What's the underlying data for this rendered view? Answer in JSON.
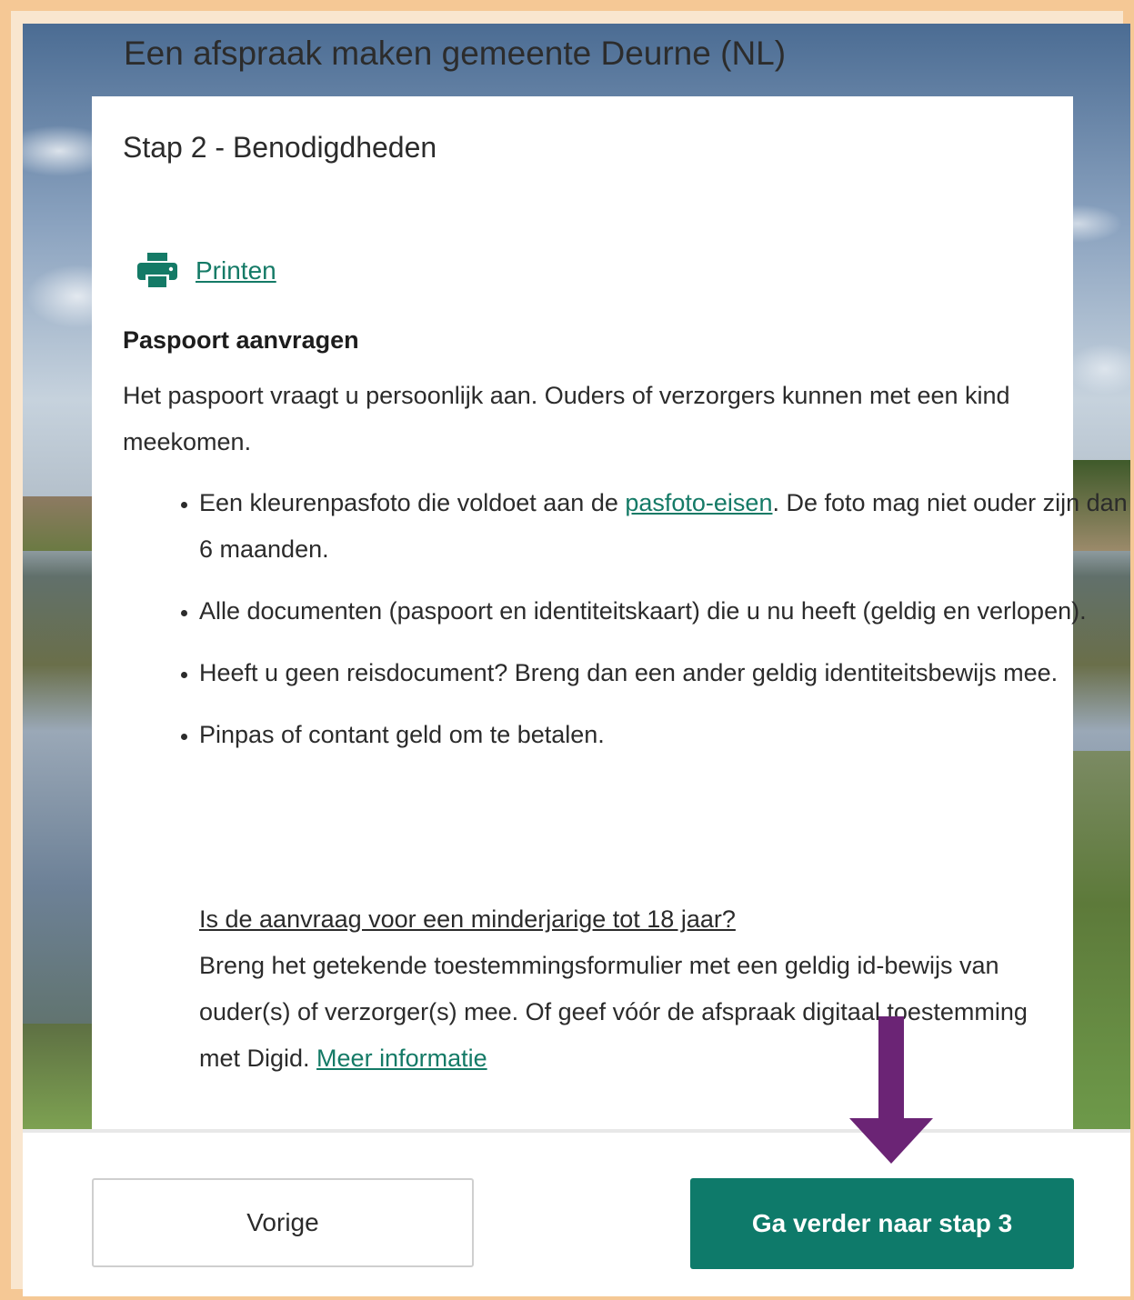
{
  "header": {
    "title": "Een afspraak maken gemeente Deurne (NL)"
  },
  "card": {
    "step_title": "Stap 2 - Benodigdheden",
    "print_label": "Printen",
    "section_heading": "Paspoort aanvragen",
    "intro": "Het paspoort vraagt u persoonlijk aan. Ouders of verzorgers kunnen met een kind meekomen.",
    "bullets": [
      {
        "before": "Een kleurenpasfoto die voldoet aan de ",
        "link": "pasfoto-eisen",
        "after": ". De foto mag niet ouder zijn dan 6 maanden."
      },
      {
        "text": "Alle documenten (paspoort en identiteitskaart) die u nu heeft (geldig en verlopen)."
      },
      {
        "text": "Heeft u geen reisdocument? Breng dan een ander geldig identiteitsbewijs mee."
      },
      {
        "text": "Pinpas of contant geld om te betalen."
      }
    ],
    "minor": {
      "question": "Is de aanvraag voor een minderjarige tot 18 jaar? ",
      "text": "Breng het getekende toestemmingsformulier met een geldig id-bewijs van ouder(s) of verzorger(s) mee. Of geef vóór de afspraak digitaal toestemming met Digid. ",
      "link": "Meer informatie"
    }
  },
  "footer": {
    "prev_label": "Vorige",
    "next_label": "Ga verder naar stap 3"
  },
  "colors": {
    "accent": "#0e7a6a",
    "link": "#147a66",
    "annotation_arrow": "#6b2475",
    "frame_border": "#f5c895"
  },
  "icons": {
    "print": "printer-icon",
    "annotation": "arrow-down-icon"
  }
}
